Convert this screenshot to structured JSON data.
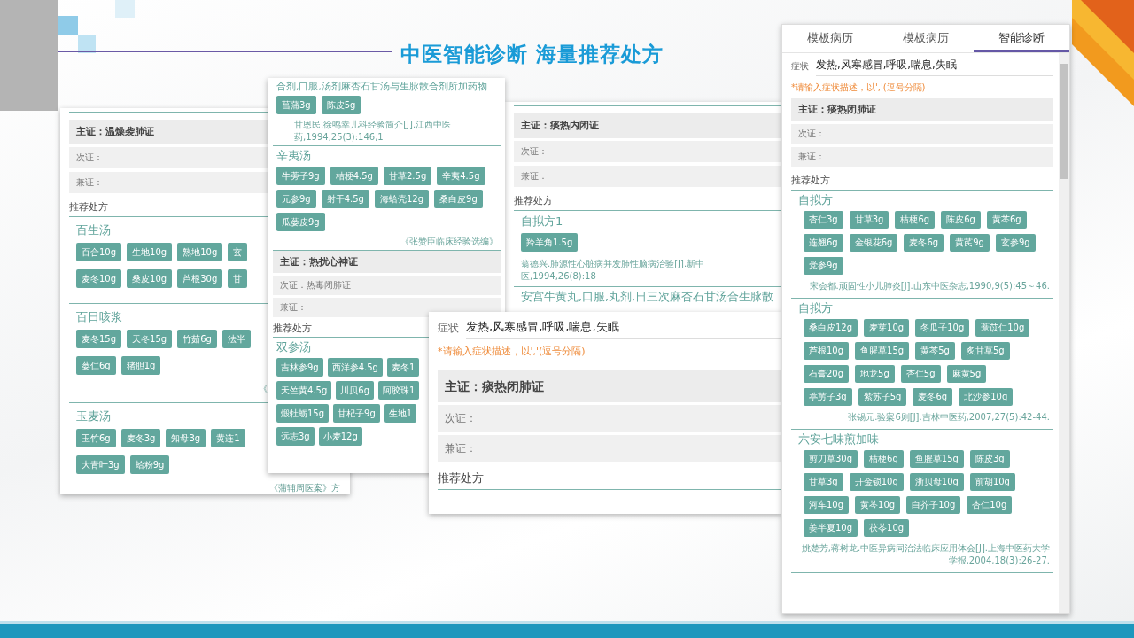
{
  "title": "中医智能诊断 海量推荐处方",
  "panels": [
    {
      "blocks": [
        {
          "kind": "rule"
        },
        {
          "kind": "main",
          "text": "主证：温燥袭肺证"
        },
        {
          "kind": "sub",
          "text": "次证："
        },
        {
          "kind": "sub",
          "text": "兼证："
        },
        {
          "kind": "section",
          "text": "推荐处方"
        },
        {
          "kind": "formula",
          "name": "百生汤",
          "rows": [
            [
              "百合10g",
              "生地10g",
              "熟地10g",
              "玄"
            ],
            [
              "麦冬10g",
              "桑皮10g",
              "芦根30g",
              "甘"
            ]
          ]
        },
        {
          "kind": "formula",
          "name": "百日咳浆",
          "rows": [
            [
              "麦冬15g",
              "天冬15g",
              "竹茹6g",
              "法半"
            ],
            [
              "蒌仁6g",
              "猪胆1g"
            ]
          ],
          "source": "《"
        },
        {
          "kind": "formula",
          "name": "玉麦汤",
          "rows": [
            [
              "玉竹6g",
              "麦冬3g",
              "知母3g",
              "黄连1"
            ],
            [
              "大青叶3g",
              "蛤粉9g"
            ]
          ],
          "source": "《蒲辅周医案》方"
        }
      ]
    },
    {
      "blocks": [
        {
          "kind": "formula",
          "name": "合剂,口服,汤剂麻杏石甘汤与生脉散合剂所加药物",
          "rows": [
            [
              "菖蒲3g",
              "陈皮5g"
            ]
          ],
          "source": "甘恩民.徐鸣幸儿科经验简介[J].江西中医药,1994,25(3):146,1"
        },
        {
          "kind": "formula",
          "name": "辛夷汤",
          "rows": [
            [
              "牛蒡子9g",
              "桔梗4.5g",
              "甘草2.5g",
              "辛夷4.5g"
            ],
            [
              "元参9g",
              "射干4.5g",
              "海蛤壳12g",
              "桑白皮9g"
            ],
            [
              "瓜蒌皮9g"
            ]
          ],
          "source": "《张赞臣临床经验选编》"
        },
        {
          "kind": "main",
          "text": "主证：热扰心神证"
        },
        {
          "kind": "sub",
          "text": "次证：热毒闭肺证"
        },
        {
          "kind": "sub",
          "text": "兼证："
        },
        {
          "kind": "section",
          "text": "推荐处方"
        },
        {
          "kind": "formula",
          "name": "双参汤",
          "rows": [
            [
              "吉林参9g",
              "西洋参4.5g",
              "麦冬1"
            ],
            [
              "天竺黄4.5g",
              "川贝6g",
              "阿胶珠1"
            ],
            [
              "煅牡蛎15g",
              "甘杞子9g",
              "生地1"
            ],
            [
              "远志3g",
              "小麦12g"
            ]
          ]
        }
      ]
    },
    {
      "blocks": [
        {
          "kind": "rule"
        },
        {
          "kind": "main",
          "text": "主证：痰热内闭证"
        },
        {
          "kind": "sub",
          "text": "次证："
        },
        {
          "kind": "sub",
          "text": "兼证："
        },
        {
          "kind": "section",
          "text": "推荐处方"
        },
        {
          "kind": "formula",
          "name": "自拟方1",
          "rows": [
            [
              "羚羊角1.5g"
            ]
          ],
          "source": "翁德兴.肺源性心脏病并发肺性脑病治验[J].新中医,1994,26(8):18"
        },
        {
          "kind": "formula",
          "name": "安宫牛黄丸,口服,丸剂,日三次麻杏石甘汤合生脉散"
        }
      ]
    },
    {
      "blocks": [
        {
          "kind": "symptom",
          "label": "症状",
          "value": "发热,风寒感冒,呼吸,喘息,失眠",
          "hint": "*请输入症状描述，以','(逗号分隔)"
        },
        {
          "kind": "main",
          "text": "主证：痰热闭肺证"
        },
        {
          "kind": "sub",
          "text": "次证："
        },
        {
          "kind": "sub",
          "text": "兼证："
        },
        {
          "kind": "section",
          "text": "推荐处方"
        }
      ]
    },
    {
      "tabs": [
        {
          "label": "模板病历",
          "selected": false
        },
        {
          "label": "模板病历",
          "selected": false
        },
        {
          "label": "智能诊断",
          "selected": true
        }
      ],
      "blocks": [
        {
          "kind": "symptom",
          "label": "症状",
          "value": "发热,风寒感冒,呼吸,喘息,失眠",
          "hint": "*请输入症状描述，以','(逗号分隔)"
        },
        {
          "kind": "main",
          "text": "主证：痰热闭肺证"
        },
        {
          "kind": "sub",
          "text": "次证："
        },
        {
          "kind": "sub",
          "text": "兼证："
        },
        {
          "kind": "section",
          "text": "推荐处方"
        },
        {
          "kind": "formula",
          "name": "自拟方",
          "rows": [
            [
              "杏仁3g",
              "甘草3g",
              "桔梗6g",
              "陈皮6g",
              "黄芩6g"
            ],
            [
              "连翘6g",
              "金银花6g",
              "麦冬6g",
              "黄芪9g",
              "玄参9g"
            ],
            [
              "党参9g"
            ]
          ],
          "source": "宋会都.顽固性小儿肺炎[J].山东中医杂志,1990,9(5):45～46."
        },
        {
          "kind": "formula",
          "name": "自拟方",
          "rows": [
            [
              "桑白皮12g",
              "麦芽10g",
              "冬瓜子10g",
              "薏苡仁10g"
            ],
            [
              "芦根10g",
              "鱼腥草15g",
              "黄芩5g",
              "炙甘草5g"
            ],
            [
              "石膏20g",
              "地龙5g",
              "杏仁5g",
              "麻黄5g"
            ],
            [
              "葶苈子3g",
              "紫苏子5g",
              "麦冬6g",
              "北沙参10g"
            ]
          ],
          "source": "张锡元.验案6则[J].吉林中医药,2007,27(5):42-44."
        },
        {
          "kind": "formula",
          "name": "六安七味煎加味",
          "rows": [
            [
              "剪刀草30g",
              "桔梗6g",
              "鱼腥草15g",
              "陈皮3g"
            ],
            [
              "甘草3g",
              "开金锁10g",
              "浙贝母10g",
              "前胡10g"
            ],
            [
              "河车10g",
              "黄芩10g",
              "白芥子10g",
              "杏仁10g"
            ],
            [
              "姜半夏10g",
              "茯苓10g"
            ]
          ],
          "source": "姚楚芳,蒋树龙.中医异病同治法临床应用体会[J].上海中医药大学学报,2004,18(3):26-27."
        }
      ]
    }
  ]
}
